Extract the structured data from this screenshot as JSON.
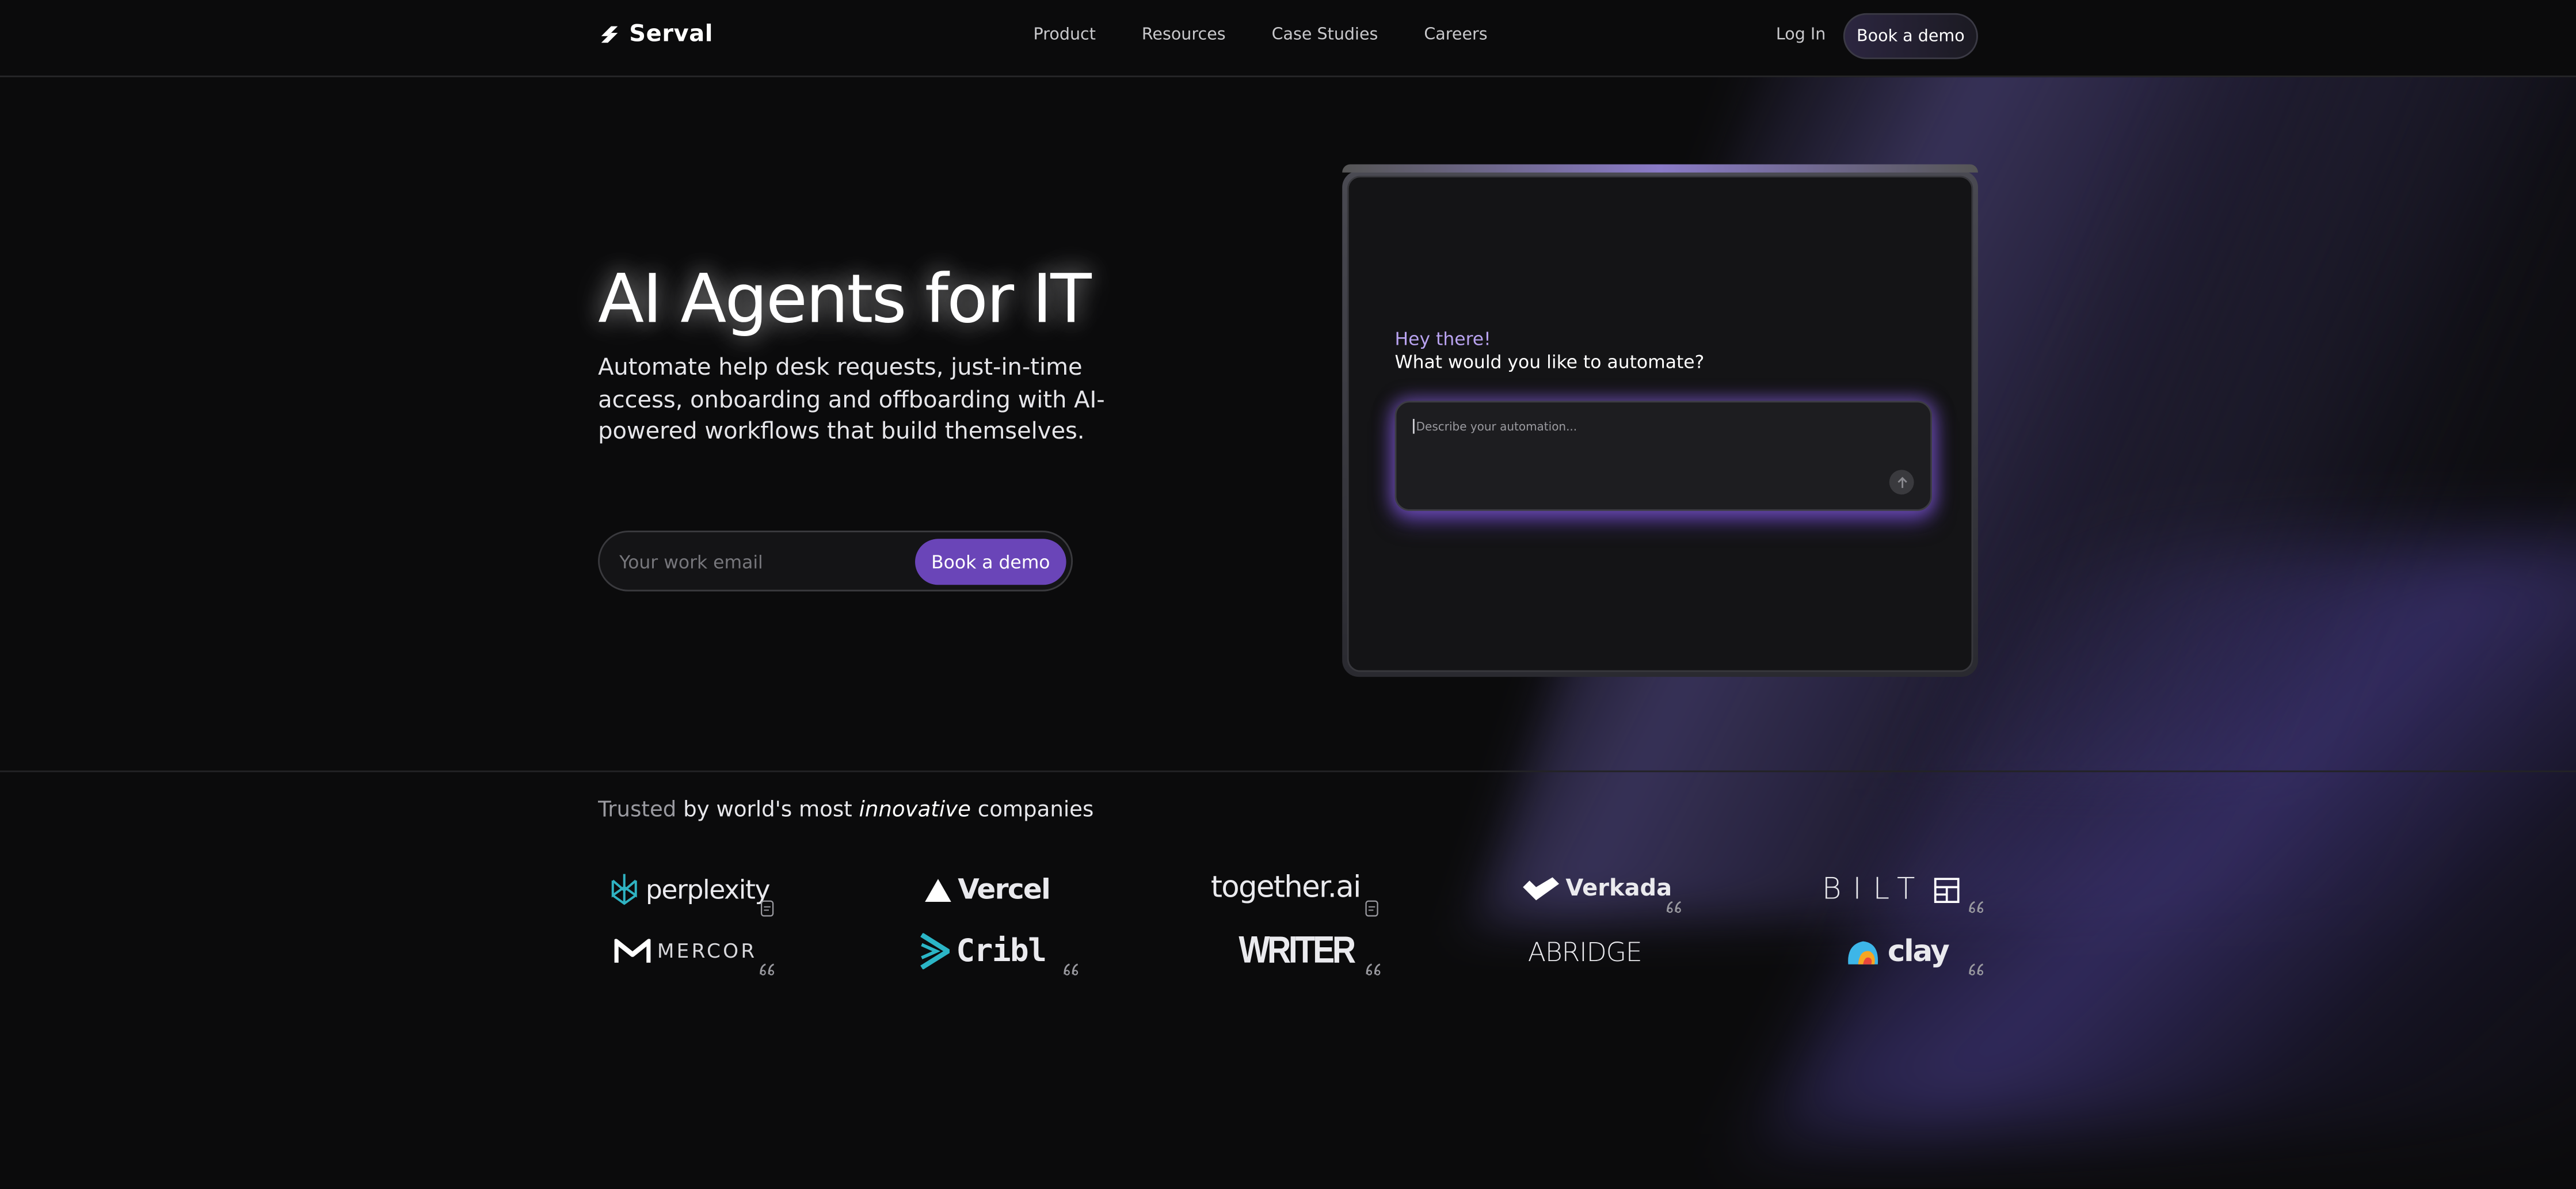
{
  "brand": {
    "name": "Serval"
  },
  "nav": {
    "items": [
      "Product",
      "Resources",
      "Case Studies",
      "Careers"
    ],
    "login": "Log In",
    "cta": "Book a demo"
  },
  "hero": {
    "title": "AI Agents for IT",
    "subtitle": "Automate help desk requests, just-in-time access, onboarding and offboarding with AI-powered workflows that build themselves.",
    "email_placeholder": "Your work email",
    "cta": "Book a demo"
  },
  "mockup": {
    "greeting": "Hey there!",
    "question": "What would you like to automate?",
    "input_placeholder": "Describe your automation..."
  },
  "trusted": {
    "prefix": "Trusted",
    "middle": "by world's most",
    "emphasis": "innovative",
    "suffix": "companies"
  },
  "logos": {
    "row1": [
      "perplexity",
      "Vercel",
      "together.ai",
      "Verkada",
      "BILT"
    ],
    "row2": [
      "MERCOR",
      "Cribl",
      "WRITER",
      "ABRIDGE",
      "clay"
    ]
  },
  "icons": [
    "serval-logo-icon",
    "arrow-up-icon",
    "perplexity-logo-icon",
    "vercel-triangle-icon",
    "verkada-logo-icon",
    "bilt-logo-icon",
    "mercor-logo-icon",
    "cribl-logo-icon",
    "clay-logo-icon",
    "case-study-badge-icon",
    "quote-badge-icon"
  ],
  "colors": {
    "accent": "#6a45b8",
    "greeting": "#b9a3f0",
    "background": "#0b0b0c",
    "glow": "#8c64e6"
  }
}
